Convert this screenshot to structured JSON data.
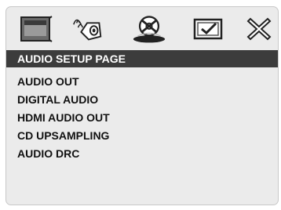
{
  "icon_tabs": [
    {
      "name": "tv-display-icon"
    },
    {
      "name": "speaker-sound-icon"
    },
    {
      "name": "disc-icon",
      "selected": true
    },
    {
      "name": "checkbox-preferences-icon"
    },
    {
      "name": "close-x-icon"
    }
  ],
  "colors": {
    "panel_background": "#ebebeb",
    "header_background": "#3c3c3c",
    "header_text": "#ffffff",
    "item_text": "#111111"
  },
  "page": {
    "title": "AUDIO SETUP PAGE",
    "items": [
      {
        "label": "AUDIO OUT"
      },
      {
        "label": "DIGITAL AUDIO"
      },
      {
        "label": "HDMI AUDIO OUT"
      },
      {
        "label": "CD UPSAMPLING"
      },
      {
        "label": "AUDIO DRC"
      }
    ]
  }
}
